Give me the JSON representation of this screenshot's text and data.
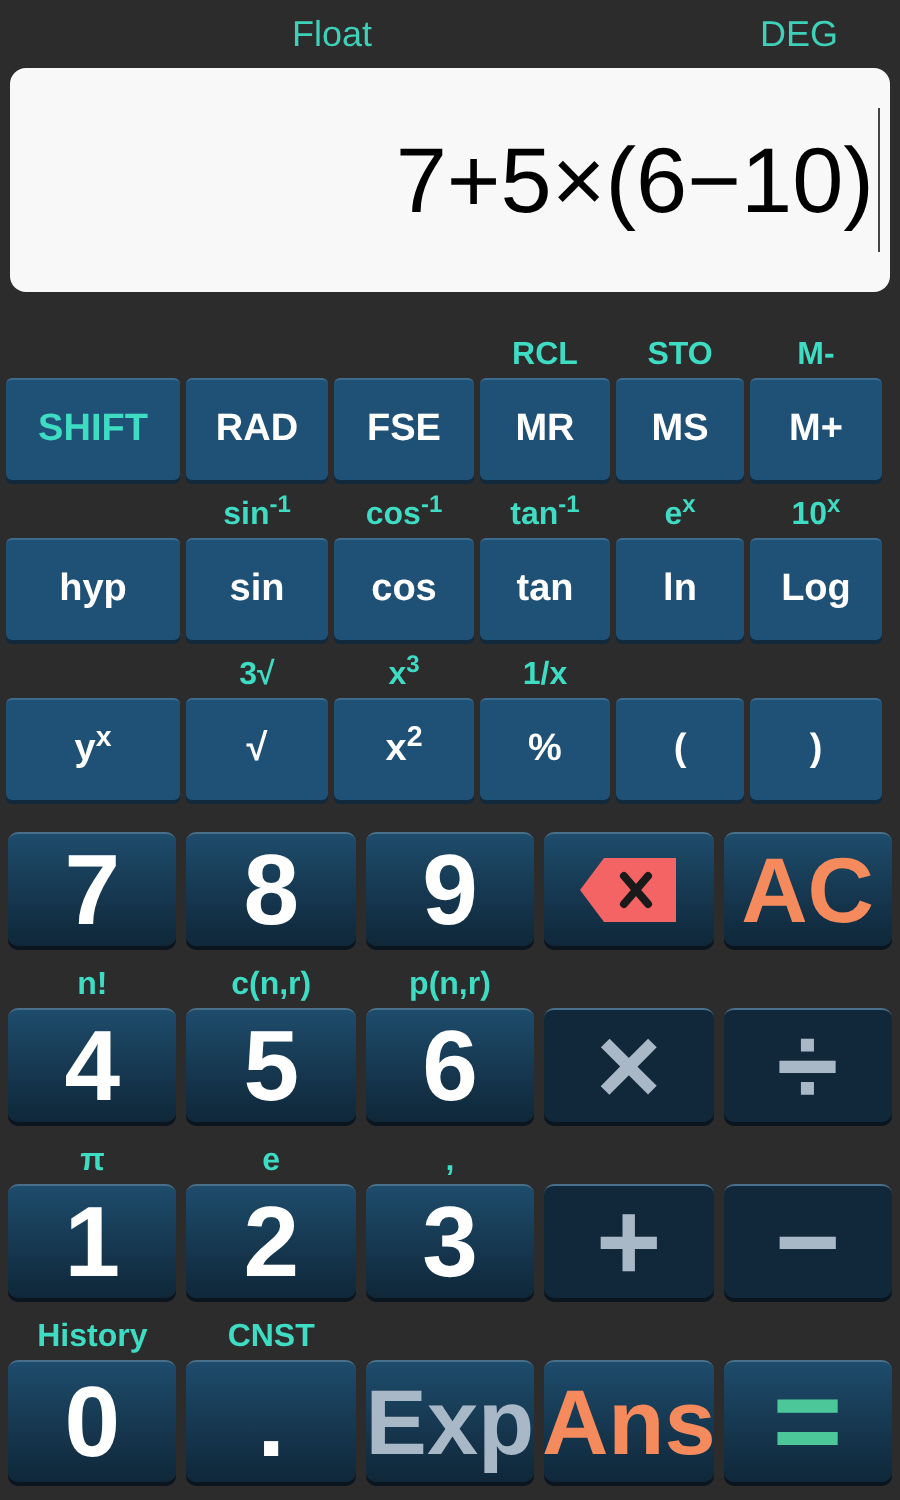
{
  "status": {
    "mode": "Float",
    "angle": "DEG"
  },
  "display": {
    "expression": "7+5×(6−10)"
  },
  "function_rows": [
    {
      "keys": [
        {
          "label": "SHIFT",
          "kind": "shift"
        },
        {
          "label": "RAD",
          "kind": "function"
        },
        {
          "label": "FSE",
          "kind": "function"
        },
        {
          "label": "MR",
          "kind": "function",
          "shift_label": "RCL"
        },
        {
          "label": "MS",
          "kind": "function",
          "shift_label": "STO"
        },
        {
          "label": "M+",
          "kind": "function",
          "shift_label": "M-"
        }
      ]
    },
    {
      "keys": [
        {
          "label": "hyp",
          "kind": "function"
        },
        {
          "label": "sin",
          "kind": "function",
          "shift_label": "sin$^{-1}$"
        },
        {
          "label": "cos",
          "kind": "function",
          "shift_label": "cos$^{-1}$"
        },
        {
          "label": "tan",
          "kind": "function",
          "shift_label": "tan$^{-1}$"
        },
        {
          "label": "ln",
          "kind": "function",
          "shift_label": "e$^{x}$"
        },
        {
          "label": "Log",
          "kind": "function",
          "shift_label": "10$^{x}$"
        }
      ]
    },
    {
      "keys": [
        {
          "label": "y$^{x}$",
          "kind": "function"
        },
        {
          "label": "√",
          "kind": "function",
          "shift_label": "3√"
        },
        {
          "label": "x$^{2}$",
          "kind": "function",
          "shift_label": "x$^{3}$"
        },
        {
          "label": "%",
          "kind": "function",
          "shift_label": "1/x"
        },
        {
          "label": "(",
          "kind": "function"
        },
        {
          "label": ")",
          "kind": "function"
        }
      ]
    }
  ],
  "number_rows": [
    {
      "keys": [
        {
          "label": "7",
          "kind": "digit"
        },
        {
          "label": "8",
          "kind": "digit"
        },
        {
          "label": "9",
          "kind": "digit"
        },
        {
          "kind": "backspace"
        },
        {
          "label": "AC",
          "kind": "accent"
        }
      ]
    },
    {
      "keys": [
        {
          "label": "4",
          "kind": "digit",
          "shift_label": "n!"
        },
        {
          "label": "5",
          "kind": "digit",
          "shift_label": "c(n,r)"
        },
        {
          "label": "6",
          "kind": "digit",
          "shift_label": "p(n,r)"
        },
        {
          "label": "×",
          "kind": "operator"
        },
        {
          "label": "÷",
          "kind": "operator"
        }
      ]
    },
    {
      "keys": [
        {
          "label": "1",
          "kind": "digit",
          "shift_label": "π"
        },
        {
          "label": "2",
          "kind": "digit",
          "shift_label": "e"
        },
        {
          "label": "3",
          "kind": "digit",
          "shift_label": ","
        },
        {
          "label": "+",
          "kind": "operator"
        },
        {
          "label": "−",
          "kind": "operator"
        }
      ]
    },
    {
      "keys": [
        {
          "label": "0",
          "kind": "digit",
          "shift_label": "History"
        },
        {
          "label": ".",
          "kind": "digit",
          "shift_label": "CNST"
        },
        {
          "label": "Exp",
          "kind": "exp"
        },
        {
          "label": "Ans",
          "kind": "accent"
        },
        {
          "label": "=",
          "kind": "equals"
        }
      ]
    }
  ]
}
